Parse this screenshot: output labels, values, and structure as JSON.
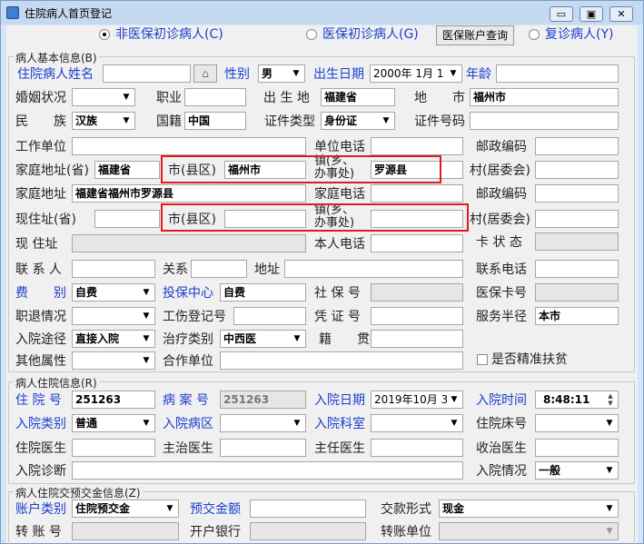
{
  "window": {
    "title": "住院病人首页登记",
    "min": "▭",
    "max": "▣",
    "close": "✕"
  },
  "top": {
    "r1": "非医保初诊病人(C)",
    "r2": "医保初诊病人(G)",
    "btn": "医保账户查询",
    "r3": "复诊病人(Y)"
  },
  "g1": {
    "label": "病人基本信息(B)"
  },
  "g2": {
    "label": "病人住院信息(R)"
  },
  "g3": {
    "label": "病人住院交预交金信息(Z)"
  },
  "lbl": {
    "name": "住院病人姓名",
    "sex": "性别",
    "birth": "出生日期",
    "age": "年龄",
    "marital": "婚姻状况",
    "job": "职业",
    "birthplace": "出 生 地",
    "city": "地　　市",
    "nation": "民　　族",
    "nationality": "国籍",
    "idtype": "证件类型",
    "idno": "证件号码",
    "workunit": "工作单位",
    "unitphone": "单位电话",
    "postcode": "邮政编码",
    "homeprov": "家庭地址(省)",
    "homecity": "市(县区)",
    "town": "镇(乡、\n办事处)",
    "village": "村(居委会)",
    "homeaddr": "家庭地址",
    "homephone": "家庭电话",
    "postcode2": "邮政编码",
    "curprov": "现住址(省)",
    "curcity": "市(县区)",
    "curtown": "镇(乡、\n办事处)",
    "curvillage": "村(居委会)",
    "curaddr": "现 住址",
    "selfphone": "本人电话",
    "cardstatus": "卡 状 态",
    "contact": "联 系 人",
    "relation": "关系",
    "addr": "地址",
    "contactphone": "联系电话",
    "fee": "费　　别",
    "insure": "投保中心",
    "socialno": "社 保 号",
    "medcard": "医保卡号",
    "retire": "职退情况",
    "injury": "工伤登记号",
    "voucher": "凭 证 号",
    "radius": "服务半径",
    "route": "入院途径",
    "treat": "治疗类别",
    "native": "籍　　贯",
    "other": "其他属性",
    "coop": "合作单位",
    "poverty": "是否精准扶贫",
    "inno": "住 院 号",
    "caseno": "病 案 号",
    "indate": "入院日期",
    "intime": "入院时间",
    "intype": "入院类别",
    "inward": "入院病区",
    "indept": "入院科室",
    "bedno": "住院床号",
    "doctor": "住院医生",
    "chief": "主治医生",
    "director": "主任医生",
    "recvdoc": "收治医生",
    "diag": "入院诊断",
    "cond": "入院情况",
    "acctype": "账户类别",
    "prepay": "预交金额",
    "payform": "交款形式",
    "transno": "转 账 号",
    "bank": "开户银行",
    "transunit": "转账单位"
  },
  "val": {
    "sex": "男",
    "birth": "2000年 1月 1",
    "birthplace": "福建省",
    "city": "福州市",
    "nation": "汉族",
    "nationality": "中国",
    "idtype": "身份证",
    "homeprov": "福建省",
    "homecity": "福州市",
    "town": "罗源县",
    "homeaddr": "福建省福州市罗源县",
    "fee": "自费",
    "insure": "自费",
    "radius": "本市",
    "route": "直接入院",
    "treat": "中西医",
    "inno": "251263",
    "caseno": "251263",
    "indate": "2019年10月 3",
    "intime": "8:48:11",
    "intype": "普通",
    "cond": "一般",
    "acctype": "住院预交金",
    "payform": "现金"
  },
  "icons": {
    "card": "card-icon",
    "dropdown": "▼",
    "spinup": "▲",
    "spindown": "▼"
  }
}
